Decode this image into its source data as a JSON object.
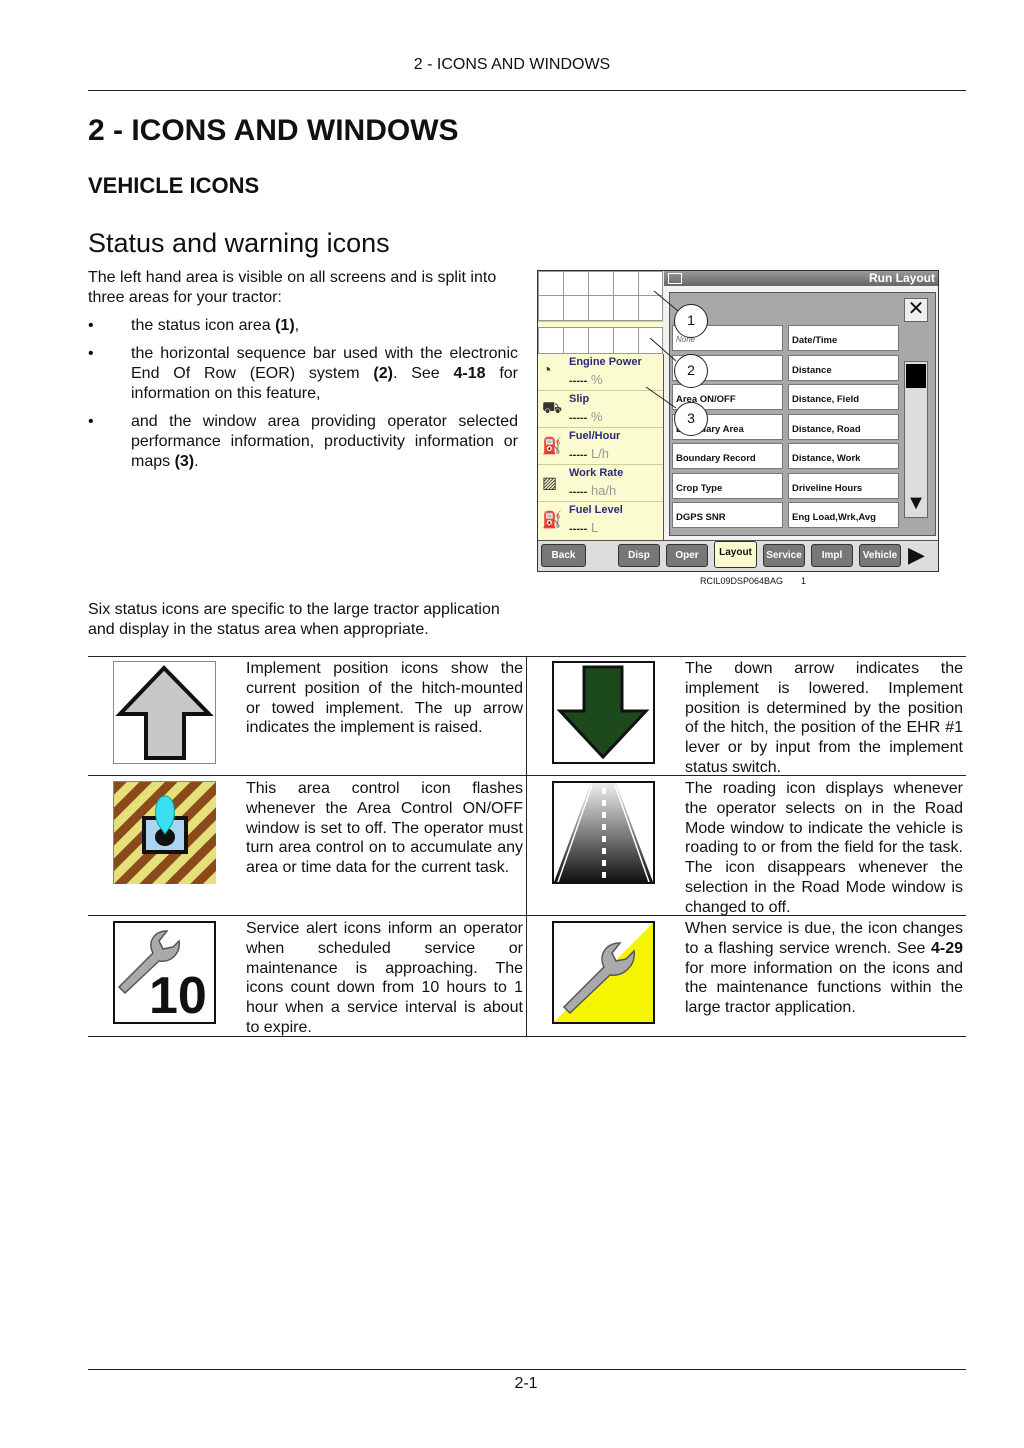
{
  "running_header": "2 - ICONS AND WINDOWS",
  "title": "2 - ICONS AND WINDOWS",
  "section": "VEHICLE ICONS",
  "subsection": "Status and warning icons",
  "intro": "The left hand area is visible on all screens and is split into three areas for your tractor:",
  "bullets": [
    {
      "pre": "the status icon area ",
      "bold": "(1)",
      "post": ","
    },
    {
      "pre": "the horizontal sequence bar used with the electronic End Of Row (EOR) system ",
      "bold": "(2)",
      "mid": ". See ",
      "bold2": "4-18",
      "post": " for information on this feature,"
    },
    {
      "pre": "and the window area providing operator selected performance information, productivity information or maps ",
      "bold": "(3)",
      "post": "."
    }
  ],
  "figure": {
    "title_bar": "Run Layout",
    "left_panel": [
      {
        "label": "Engine Power",
        "value": "-----",
        "unit": "%",
        "icon": "engine-power-icon"
      },
      {
        "label": "Slip",
        "value": "-----",
        "unit": "%",
        "icon": "tractor-slip-icon"
      },
      {
        "label": "Fuel/Hour",
        "value": "-----",
        "unit": "L/h",
        "icon": "fuel-hour-icon"
      },
      {
        "label": "Work Rate",
        "value": "-----",
        "unit": "ha/h",
        "icon": "work-rate-icon"
      },
      {
        "label": "Fuel Level",
        "value": "-----",
        "unit": "L",
        "icon": "fuel-level-icon"
      }
    ],
    "options_col1": [
      "None",
      "",
      "Area ON/OFF",
      "Boundary Area",
      "Boundary Record",
      "Crop Type",
      "DGPS SNR"
    ],
    "options_col2": [
      "Date/Time",
      "Distance",
      "Distance, Field",
      "Distance, Road",
      "Distance, Work",
      "Driveline Hours",
      "Eng Load,Wrk,Avg"
    ],
    "tabs": [
      "Back",
      "Disp",
      "Oper",
      "Layout",
      "Service",
      "Impl",
      "Vehicle"
    ],
    "active_tab": "Layout",
    "callouts": [
      "1",
      "2",
      "3"
    ],
    "code": "RCIL09DSP064BAG",
    "number": "1"
  },
  "para2": "Six status icons are specific to the large tractor application and display in the status area when appropriate.",
  "table": [
    {
      "left_text": "Implement position icons show the current position of the hitch-mounted or towed implement. The up arrow indicates the implement is raised.",
      "right_text": "The down arrow indicates the implement is lowered. Implement position is determined by the position of the hitch, the position of the EHR #1 lever or by input from the implement status switch."
    },
    {
      "left_text": "This area control icon flashes whenever the Area Control ON/OFF window is set to off. The operator must turn area control on to accumulate any area or time data for the current task.",
      "right_text": "The roading icon displays whenever the operator selects on in the Road Mode window to indicate the vehicle is roading to or from the field for the task. The icon disappears whenever the selection in the Road Mode window is changed to off."
    },
    {
      "left_text": "Service alert icons inform an operator when scheduled service or maintenance is approaching. The icons count down from 10 hours to 1 hour when a service interval is about to expire.",
      "right_pre": "When service is due, the icon changes to a flashing service wrench. See ",
      "right_bold": "4-29",
      "right_post": " for more information on the icons and the maintenance functions within the large tractor application."
    }
  ],
  "service_count": "10",
  "colors": {
    "panel_yellow": "#fbfbd0",
    "arrow_green": "#1d4a1d",
    "arrow_gray": "#c8c8c8",
    "service_yellow": "#f5f500"
  },
  "page_number": "2-1"
}
